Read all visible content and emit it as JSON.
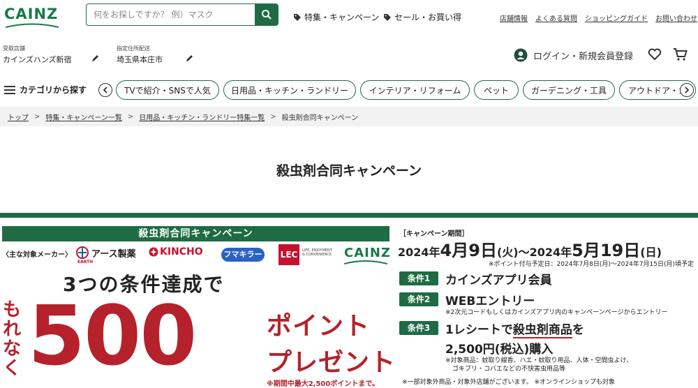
{
  "header": {
    "logo": "CAINZ",
    "search_placeholder": "何をお探しですか？ 例）マスク",
    "tag1": "特集・キャンペーン",
    "tag2": "セール・お買い得",
    "links": [
      "店舗情報",
      "よくある質問",
      "ショッピングガイド",
      "お問い合わせ"
    ]
  },
  "store": {
    "pickup_label": "受取店舗",
    "pickup_value": "カインズハンズ新宿",
    "delivery_label": "指定住所配送",
    "delivery_value": "埼玉県本庄市"
  },
  "account": {
    "login": "ログイン・新規会員登録"
  },
  "categories": {
    "menu": "カテゴリから探す",
    "pills": [
      "TVで紹介・SNSで人気",
      "日用品・キッチン・ランドリー",
      "インテリア・リフォーム",
      "ペット",
      "ガーデニング・工具",
      "アウトドア・カ"
    ]
  },
  "breadcrumb": [
    "トップ",
    "特集・キャンペーン一覧",
    "日用品・キッチン・ランドリー特集一覧",
    "殺虫剤合同キャンペーン"
  ],
  "page_title": "殺虫剤合同キャンペーン",
  "banner": {
    "title": "殺虫剤合同キャンペーン",
    "makers_label": "〈主な対象メーカー〉",
    "maker_earth": "アース製薬",
    "maker_earth_small": "EARTH",
    "maker_kincho": "KINCHO",
    "maker_fumakira": "フマキラー",
    "maker_lec": "LEC",
    "maker_lec_small": "LIFE, ENJOYMENT & CONVENIENCE",
    "maker_cainz": "CAINZ",
    "headline": "3つの条件達成で",
    "morenaku": "もれなく",
    "amount": "500",
    "point": "ポイント",
    "present": "プレゼント",
    "max_note": "※期間中最大2,500ポイントまで。",
    "period_label": "［キャンペーン期間］",
    "period_y1": "2024年",
    "period_d1": "4月9日",
    "period_w1": "(火)",
    "period_sep": "～",
    "period_y2": "2024年",
    "period_d2": "5月19日",
    "period_w2": "(日)",
    "point_date_note": "※ポイント付与予定日：2024年7月8日(月)～2024年7月15日(月)頃予定",
    "cond1_label": "条件1",
    "cond1_text": "カインズアプリ会員",
    "cond2_label": "条件2",
    "cond2_text": "WEBエントリー",
    "cond2_note": "※2次元コードもしくはカインズアプリ内のキャンペーンページからエントリー",
    "cond3_label": "条件3",
    "cond3_text_a": "1レシートで",
    "cond3_text_b": "殺虫剤商品",
    "cond3_text_c": "を",
    "cond3_text2": "2,500円(税込)購入",
    "cond3_note1": "※対象商品：蚊取り線香、ハエ・蚊取り用品、人体・空間虫よけ、",
    "cond3_note2": "ゴキブリ・コバエなどの不快害虫用品等",
    "bottom_note": "※一部対象外商品・対象外店舗がございます。 ※オンラインショップも対象"
  },
  "colors": {
    "brand": "#1f6b43",
    "accent_red": "#b5222b"
  }
}
